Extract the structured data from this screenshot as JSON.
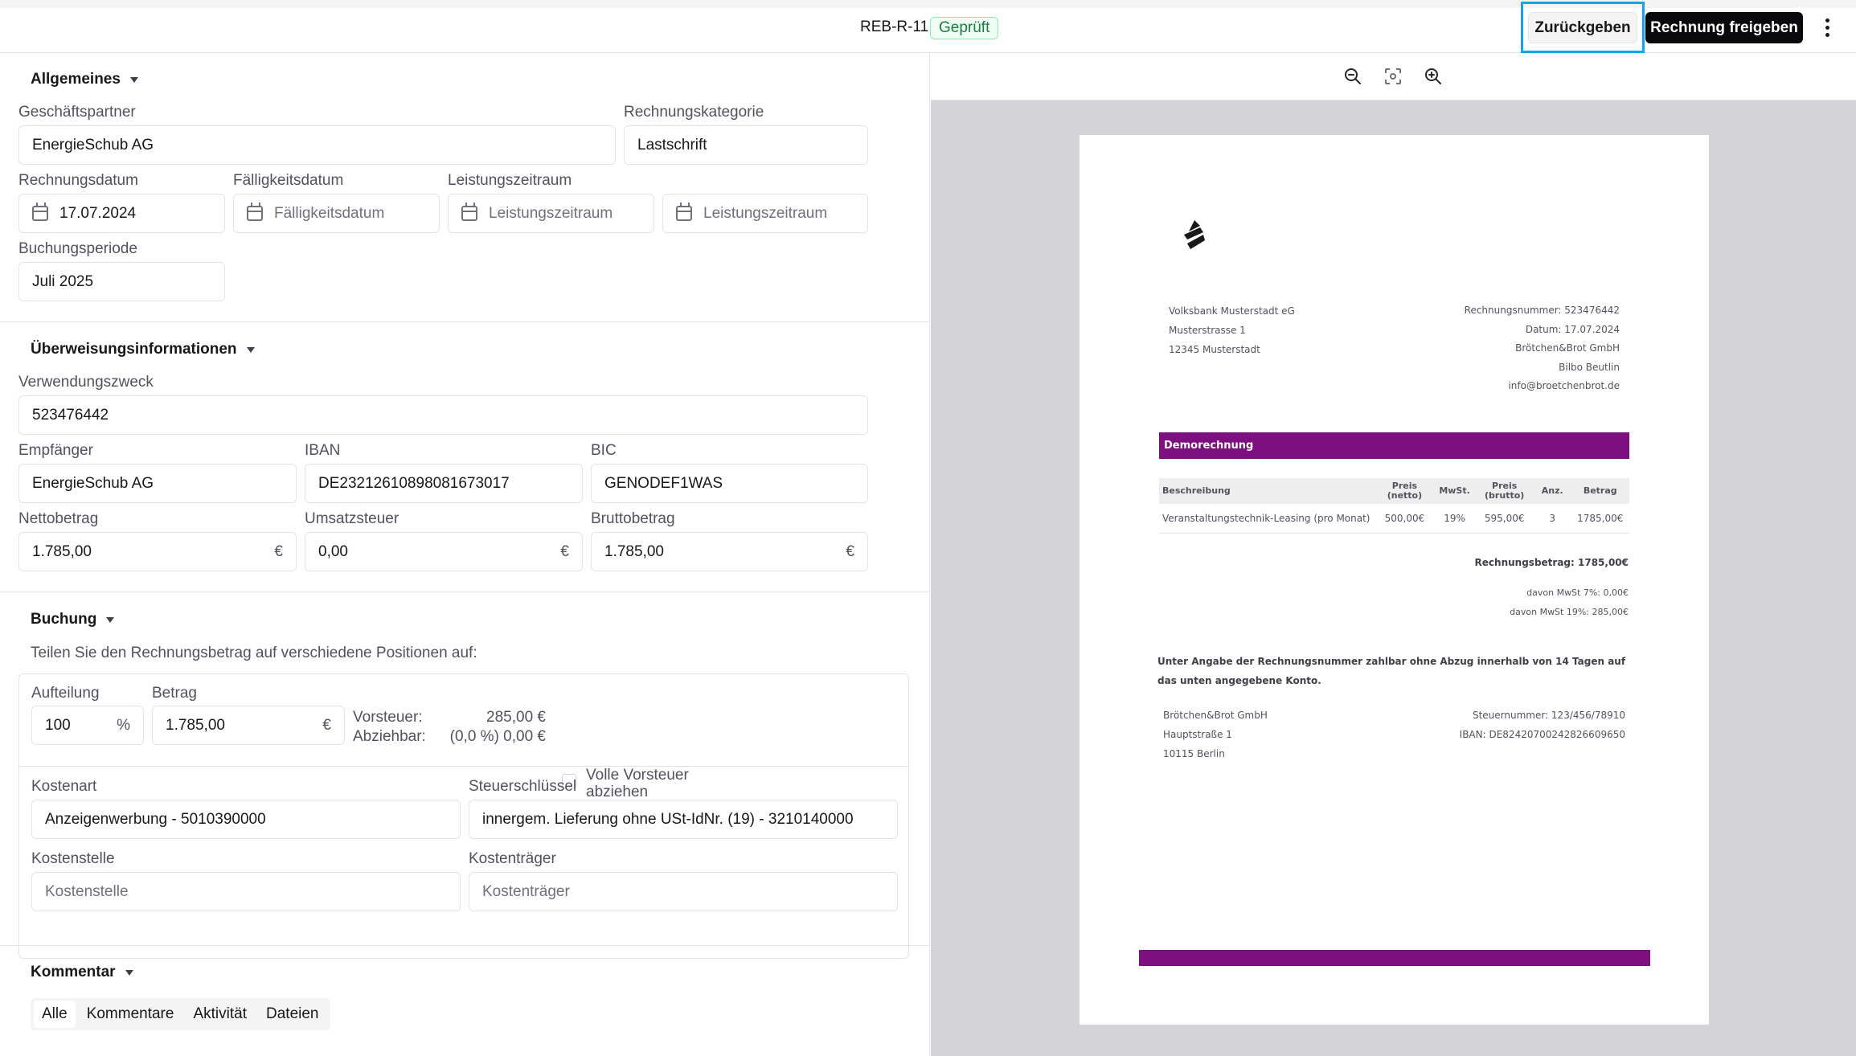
{
  "header": {
    "doc_id": "REB-R-11",
    "status": "Geprüft",
    "return_button": "Zurückgeben",
    "release_button": "Rechnung freigeben",
    "more_icon": "more-vertical-icon"
  },
  "general": {
    "title": "Allgemeines",
    "partner_label": "Geschäftspartner",
    "partner_value": "EnergieSchub AG",
    "category_label": "Rechnungskategorie",
    "category_value": "Lastschrift",
    "invoice_date_label": "Rechnungsdatum",
    "invoice_date_value": "17.07.2024",
    "due_date_label": "Fälligkeitsdatum",
    "due_date_placeholder": "Fälligkeitsdatum",
    "period_label": "Leistungszeitraum",
    "period_from_placeholder": "Leistungszeitraum",
    "period_to_placeholder": "Leistungszeitraum",
    "booking_period_label": "Buchungsperiode",
    "booking_period_value": "Juli 2025"
  },
  "transfer": {
    "title": "Überweisungsinformationen",
    "purpose_label": "Verwendungszweck",
    "purpose_value": "523476442",
    "recipient_label": "Empfänger",
    "recipient_value": "EnergieSchub AG",
    "iban_label": "IBAN",
    "iban_value": "DE23212610898081673017",
    "bic_label": "BIC",
    "bic_value": "GENODEF1WAS",
    "net_label": "Nettobetrag",
    "net_value": "1.785,00",
    "vat_label": "Umsatzsteuer",
    "vat_value": "0,00",
    "gross_label": "Bruttobetrag",
    "gross_value": "1.785,00",
    "currency": "€"
  },
  "booking": {
    "title": "Buchung",
    "helper": "Teilen Sie den Rechnungsbetrag auf verschiedene Positionen auf:",
    "split_label": "Aufteilung",
    "split_value": "100",
    "split_unit": "%",
    "amount_label": "Betrag",
    "amount_value": "1.785,00",
    "amount_unit": "€",
    "input_tax_label": "Vorsteuer:",
    "input_tax_value": "285,00 €",
    "deductible_label": "Abziehbar:",
    "deductible_value": "(0,0 %) 0,00 €",
    "full_input_tax_label": "Volle Vorsteuer abziehen",
    "cost_type_label": "Kostenart",
    "cost_type_value": "Anzeigenwerbung - 5010390000",
    "tax_key_label": "Steuerschlüssel",
    "tax_key_value": "innergem. Lieferung ohne USt-IdNr. (19) - 3210140000",
    "cost_center_label": "Kostenstelle",
    "cost_center_placeholder": "Kostenstelle",
    "cost_unit_label": "Kostenträger",
    "cost_unit_placeholder": "Kostenträger"
  },
  "comment": {
    "title": "Kommentar",
    "tabs": [
      "Alle",
      "Kommentare",
      "Aktivität",
      "Dateien"
    ]
  },
  "pdf_toolbar": {
    "zoom_out_icon": "zoom-out-icon",
    "fit_icon": "fit-screen-icon",
    "zoom_in_icon": "zoom-in-icon"
  },
  "invoice_document": {
    "sender": [
      "Volksbank Musterstadt eG",
      "Musterstrasse 1",
      "12345 Musterstadt"
    ],
    "meta": [
      "Rechnungsnummer: 523476442",
      "Datum: 17.07.2024",
      "Brötchen&Brot GmbH",
      "Bilbo Beutlin",
      "info@broetchenbrot.de"
    ],
    "banner": "Demorechnung",
    "table_headers": [
      "Beschreibung",
      "Preis (netto)",
      "MwSt.",
      "Preis (brutto)",
      "Anz.",
      "Betrag"
    ],
    "row": [
      "Veranstaltungstechnik-Leasing (pro Monat)",
      "500,00€",
      "19%",
      "595,00€",
      "3",
      "1785,00€"
    ],
    "total": "Rechnungsbetrag: 1785,00€",
    "tax_lines": [
      "davon MwSt 7%: 0,00€",
      "davon MwSt 19%: 285,00€"
    ],
    "note": "Unter Angabe der Rechnungsnummer zahlbar ohne Abzug innerhalb von 14 Tagen auf das unten angegebene Konto.",
    "footer_left": [
      "Brötchen&Brot GmbH",
      "Hauptstraße 1",
      "10115 Berlin"
    ],
    "footer_right": [
      "Steuernummer: 123/456/78910",
      "IBAN: DE82420700242826609650"
    ],
    "accent_color": "#7e0f7e"
  }
}
